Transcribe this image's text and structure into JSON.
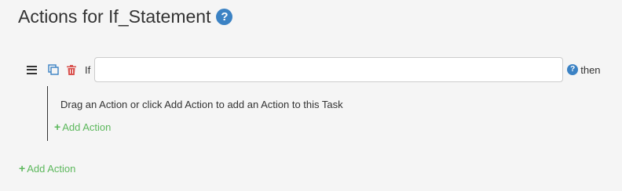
{
  "header": {
    "title": "Actions for If_Statement",
    "help_icon": "question-circle-icon"
  },
  "action": {
    "drag_icon": "bars-icon",
    "copy_icon": "copy-icon",
    "delete_icon": "trash-icon",
    "if_label": "If",
    "condition_value": "",
    "condition_placeholder": "",
    "help_icon": "question-circle-icon",
    "then_label": "then"
  },
  "nested": {
    "hint": "Drag an Action or click Add Action to add an Action to this Task",
    "add_label": "Add Action"
  },
  "footer": {
    "add_label": "Add Action"
  },
  "colors": {
    "accent_blue": "#3b82c4",
    "add_green": "#5cb85c",
    "delete_red": "#d9534f",
    "copy_blue": "#3b82c4"
  }
}
